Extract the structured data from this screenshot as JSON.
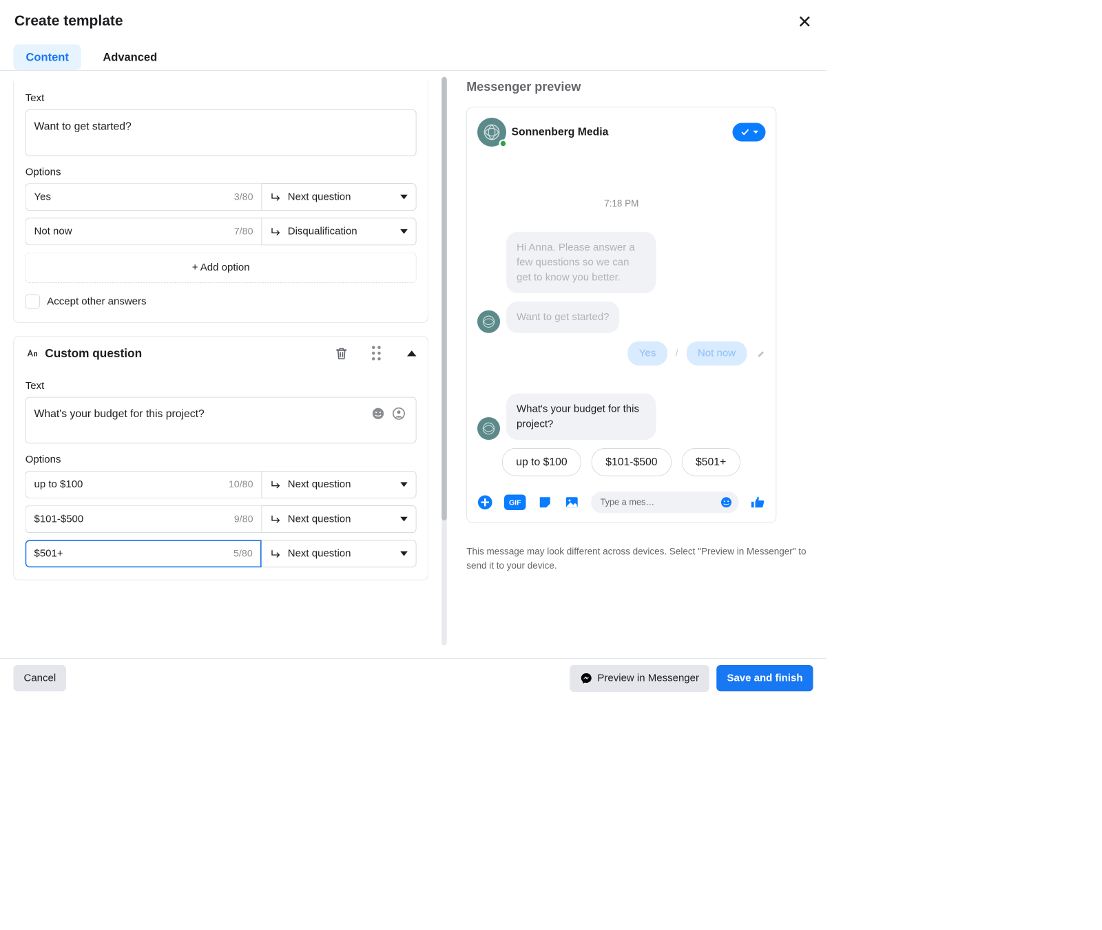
{
  "header": {
    "title": "Create template"
  },
  "tabs": {
    "content": "Content",
    "advanced": "Advanced"
  },
  "section1": {
    "text_label": "Text",
    "text_value": "Want to get started?",
    "options_label": "Options",
    "options": [
      {
        "value": "Yes",
        "counter": "3/80",
        "action": "Next question"
      },
      {
        "value": "Not now",
        "counter": "7/80",
        "action": "Disqualification"
      }
    ],
    "add_option": "+ Add option",
    "accept_other": "Accept other answers"
  },
  "section2": {
    "heading": "Custom question",
    "text_label": "Text",
    "text_value": "What's your budget for this project?",
    "options_label": "Options",
    "options": [
      {
        "value": "up to $100",
        "counter": "10/80",
        "action": "Next question"
      },
      {
        "value": "$101-$500",
        "counter": "9/80",
        "action": "Next question"
      },
      {
        "value": "$501+",
        "counter": "5/80",
        "action": "Next question"
      }
    ]
  },
  "preview": {
    "title": "Messenger preview",
    "brand": "Sonnenberg Media",
    "time": "7:18 PM",
    "intro": "Hi Anna. Please answer a few questions so we can get to know you better.",
    "q1": "Want to get started?",
    "q1_choices": [
      "Yes",
      "Not now"
    ],
    "q2": "What's your budget for this project?",
    "q2_choices": [
      "up to $100",
      "$101-$500",
      "$501+"
    ],
    "composer_placeholder": "Type a mes…",
    "gif_label": "GIF",
    "note": "This message may look different across devices. Select \"Preview in Messenger\" to send it to your device."
  },
  "footer": {
    "cancel": "Cancel",
    "preview": "Preview in Messenger",
    "save": "Save and finish"
  }
}
